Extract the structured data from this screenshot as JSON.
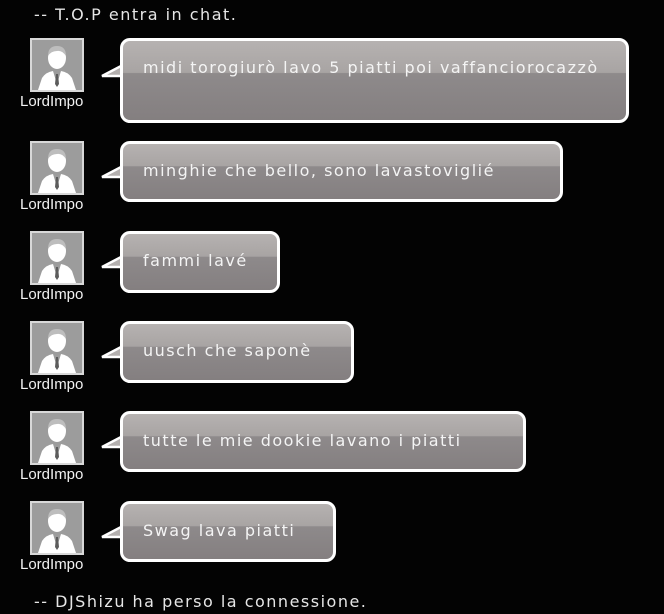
{
  "system_messages": {
    "join": "-- T.O.P entra in chat.",
    "disconnect": "-- DJShizu ha perso la connessione."
  },
  "messages": [
    {
      "user": "LordImpo",
      "text": "midi torogiurò lavo 5 piatti poi vaffanciorocazzò"
    },
    {
      "user": "LordImpo",
      "text": "minghie che bello, sono lavastoviglié"
    },
    {
      "user": "LordImpo",
      "text": "fammi lavé"
    },
    {
      "user": "LordImpo",
      "text": "uusch che saponè"
    },
    {
      "user": "LordImpo",
      "text": "tutte le mie dookie lavano i piatti"
    },
    {
      "user": "LordImpo",
      "text": "Swag lava piatti"
    }
  ],
  "icons": {
    "avatar": "default-user-avatar-icon"
  },
  "colors": {
    "background": "#030303",
    "bubble_border": "#ffffff",
    "bubble_top": "#b6b2b1",
    "bubble_bottom": "#847f80"
  }
}
